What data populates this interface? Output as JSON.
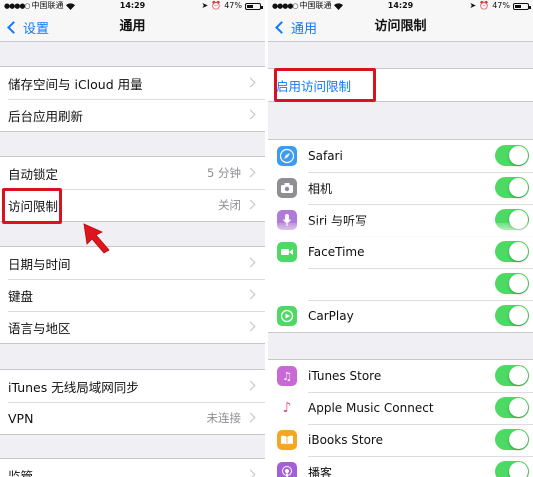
{
  "status_bar": {
    "carrier": "中国联通",
    "time": "14:29",
    "battery": "47%"
  },
  "left_screen": {
    "nav": {
      "back_label": "设置",
      "title": "通用"
    },
    "groups": [
      {
        "items": [
          {
            "label": "储存空间与 iCloud 用量",
            "value": ""
          },
          {
            "label": "后台应用刷新",
            "value": ""
          }
        ]
      },
      {
        "items": [
          {
            "label": "自动锁定",
            "value": "5 分钟"
          },
          {
            "label": "访问限制",
            "value": "关闭"
          }
        ]
      },
      {
        "items": [
          {
            "label": "日期与时间",
            "value": ""
          },
          {
            "label": "键盘",
            "value": ""
          },
          {
            "label": "语言与地区",
            "value": ""
          }
        ]
      },
      {
        "items": [
          {
            "label": "iTunes 无线局域网同步",
            "value": ""
          },
          {
            "label": "VPN",
            "value": "未连接"
          }
        ]
      },
      {
        "items": [
          {
            "label": "监管",
            "value": ""
          }
        ]
      }
    ]
  },
  "right_screen": {
    "nav": {
      "back_label": "通用",
      "title": "访问限制"
    },
    "enable_label": "启用访问限制",
    "apps_group_1": [
      {
        "label": "Safari",
        "icon": "safari-icon",
        "color": "#3d9bf0",
        "enabled": true
      },
      {
        "label": "相机",
        "icon": "camera-icon",
        "color": "#8e8e93",
        "enabled": true
      },
      {
        "label": "Siri 与听写",
        "icon": "siri-icon",
        "color": "#b07ad8",
        "enabled": true
      },
      {
        "label": "FaceTime",
        "icon": "facetime-icon",
        "color": "#4cd964",
        "enabled": true
      },
      {
        "label": "",
        "icon": "",
        "color": "",
        "enabled": true
      },
      {
        "label": "CarPlay",
        "icon": "carplay-icon",
        "color": "#4cd964",
        "enabled": true
      }
    ],
    "apps_group_2": [
      {
        "label": "iTunes Store",
        "icon": "itunes-store-icon",
        "color": "#c86ad6",
        "enabled": true
      },
      {
        "label": "Apple Music Connect",
        "icon": "music-icon",
        "color": "#ffffff",
        "enabled": true
      },
      {
        "label": "iBooks Store",
        "icon": "ibooks-icon",
        "color": "#f5a623",
        "enabled": true
      },
      {
        "label": "播客",
        "icon": "podcasts-icon",
        "color": "#a35fd6",
        "enabled": true
      }
    ]
  },
  "colors": {
    "accent": "#0a7aff",
    "highlight": "#d7141e",
    "toggle_on": "#4cd964"
  }
}
